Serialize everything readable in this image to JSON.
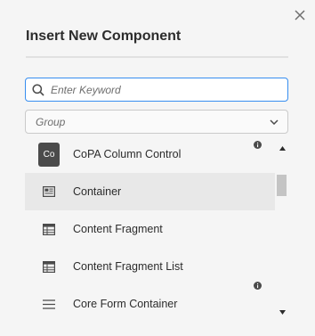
{
  "dialog": {
    "title": "Insert New Component",
    "close_icon": "close-icon"
  },
  "search": {
    "placeholder": "Enter Keyword",
    "value": "",
    "icon": "search-icon"
  },
  "group_select": {
    "value": "Group",
    "icon": "chevron-down-icon"
  },
  "components": [
    {
      "label": "CoPA Column Control",
      "icon": "co-badge",
      "badge_text": "Co",
      "info": true
    },
    {
      "label": "Container",
      "icon": "container-icon",
      "selected": true,
      "info": false
    },
    {
      "label": "Content Fragment",
      "icon": "table-icon",
      "info": false
    },
    {
      "label": "Content Fragment List",
      "icon": "table-icon",
      "info": false
    },
    {
      "label": "Core Form Container",
      "icon": "menu-lines-icon",
      "info": true
    }
  ],
  "scrollbar": {
    "position": 0.15
  },
  "colors": {
    "accent": "#378ef0",
    "background": "#f5f5f5",
    "selected_row": "#e8e8e8",
    "text": "#2c2c2c"
  }
}
